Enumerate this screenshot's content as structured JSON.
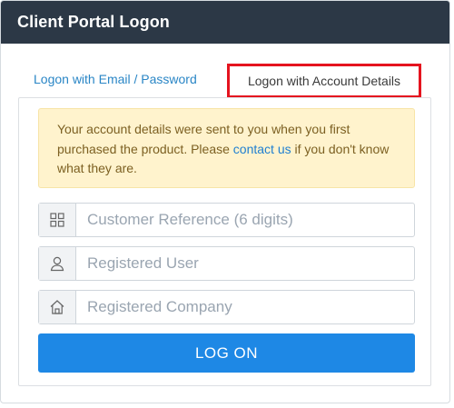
{
  "panel": {
    "title": "Client Portal Logon"
  },
  "tabs": [
    {
      "label": "Logon with Email / Password",
      "active": false
    },
    {
      "label": "Logon with Account Details",
      "active": true
    }
  ],
  "alert": {
    "text_before": "Your account details were sent to you when you first purchased the product. Please ",
    "link_text": "contact us",
    "text_after": " if you don't know what they are."
  },
  "fields": [
    {
      "icon": "grid-icon",
      "placeholder": "Customer Reference (6 digits)",
      "value": ""
    },
    {
      "icon": "user-icon",
      "placeholder": "Registered User",
      "value": ""
    },
    {
      "icon": "home-icon",
      "placeholder": "Registered Company",
      "value": ""
    }
  ],
  "submit": {
    "label": "LOG ON"
  },
  "colors": {
    "header_bg": "#2c3846",
    "active_tab_border": "#e5141f",
    "link": "#2a86c6",
    "alert_bg": "#fff3cd",
    "button_bg": "#1e88e5"
  }
}
